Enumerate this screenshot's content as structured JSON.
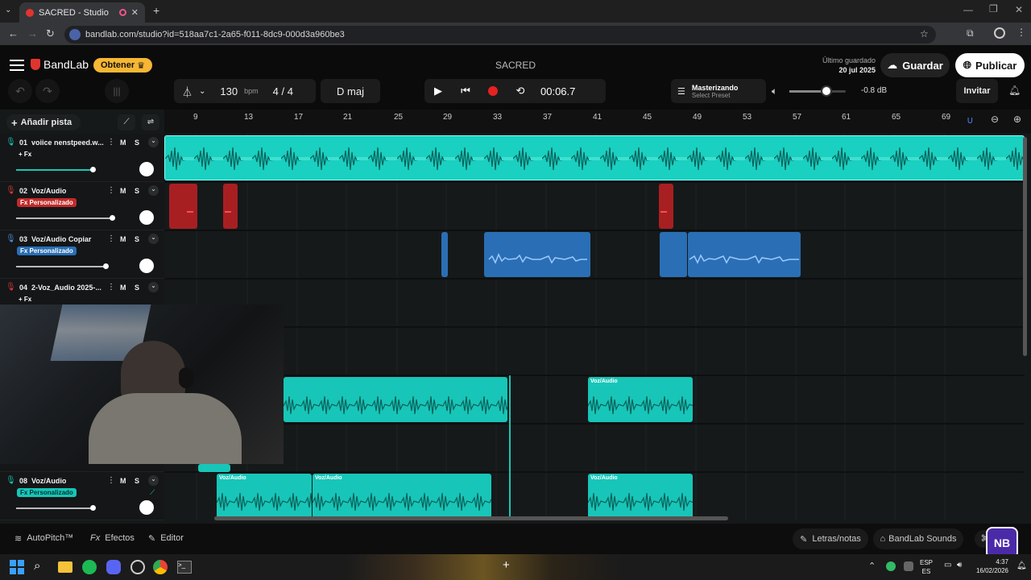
{
  "browser": {
    "tab_title": "SACRED - Studio",
    "url": "bandlab.com/studio?id=518aa7c1-2a65-f011-8dc9-000d3a960be3"
  },
  "header": {
    "brand": "BandLab",
    "get_button": "Obtener",
    "project_title": "SACRED",
    "last_saved_label": "Último guardado",
    "last_saved_date": "20 jul 2025",
    "save_button": "Guardar",
    "publish_button": "Publicar"
  },
  "toolbar": {
    "tempo": "130",
    "tempo_unit": "bpm",
    "time_signature": "4 / 4",
    "key": "D maj",
    "time_display": "00:06.7",
    "mastering_label": "Masterizando",
    "mastering_preset": "Select Preset",
    "master_volume": "-0.8 dB",
    "invite_button": "Invitar"
  },
  "left_panel": {
    "add_track": "Añadir pista"
  },
  "ruler": [
    "9",
    "13",
    "17",
    "21",
    "25",
    "29",
    "33",
    "37",
    "41",
    "45",
    "49",
    "53",
    "57",
    "61",
    "65",
    "69"
  ],
  "tracks": [
    {
      "num": "01",
      "name": "voiice nenstpeed.w...",
      "fx": "+ Fx"
    },
    {
      "num": "02",
      "name": "Voz/Audio",
      "fx": "Fx Personalizado"
    },
    {
      "num": "03",
      "name": "Voz/Audio Copiar",
      "fx": "Fx Personalizado"
    },
    {
      "num": "04",
      "name": "2-Voz_Audio 2025-...",
      "fx": "+ Fx"
    },
    {
      "num": "08",
      "name": "Voz/Audio",
      "fx": "Fx Personalizado"
    }
  ],
  "mute_label": "M",
  "solo_label": "S",
  "clip_label": "Voz/Audio",
  "bottom": {
    "autopitch": "AutoPitch™",
    "effects": "Efectos",
    "editor": "Editor",
    "lyrics": "Letras/notas",
    "sounds": "BandLab Sounds"
  },
  "taskbar": {
    "lang_top": "ESP",
    "lang_bottom": "ES",
    "time": "4:37",
    "date": "16/02/2026"
  },
  "colors": {
    "accent_teal": "#17c6b8",
    "accent_blue": "#2a6fb5",
    "accent_red": "#c22a2a",
    "get_yellow": "#f7b733"
  }
}
